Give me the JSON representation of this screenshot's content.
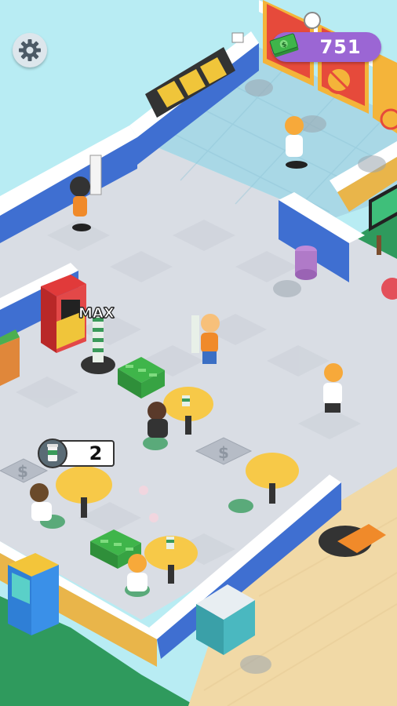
{
  "hud": {
    "money": "751",
    "order_count": "2",
    "max_label": "MAX"
  },
  "icons": {
    "settings": "gear-icon",
    "money": "cash-stack-icon",
    "order": "coffee-cup-icon"
  },
  "colors": {
    "money_pill": "#9b66d4",
    "floor": "#d9dde4",
    "wall_blue": "#3f6fd1",
    "bathroom_tile": "#a9d8e6",
    "grass": "#2f9a5d",
    "carpet": "#f1d9a6",
    "table": "#f7c948"
  }
}
